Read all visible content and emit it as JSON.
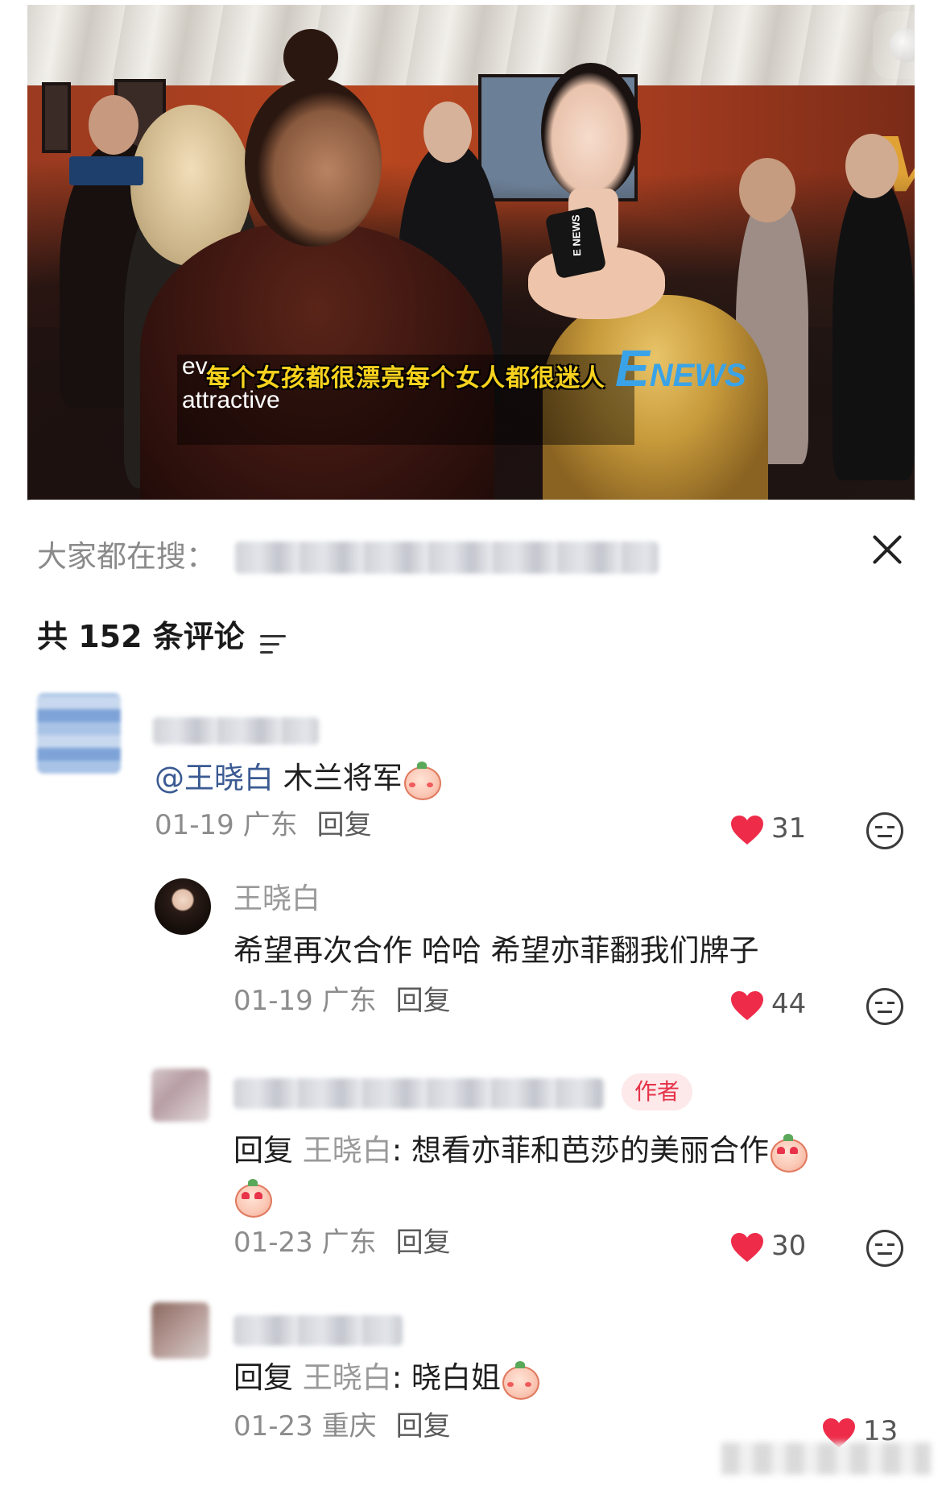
{
  "video": {
    "subtitle_en_line1": "ev",
    "subtitle_en_line2": "attractive",
    "subtitle_zh": "每个女孩都很漂亮每个女人都很迷人",
    "logo_e": "E",
    "logo_news": "NEWS",
    "mic_label": "E NEWS"
  },
  "search": {
    "label": "大家都在搜："
  },
  "comments_header": {
    "count_text": "共 152 条评论"
  },
  "comments": [
    {
      "mention": "@王晓白",
      "text": " 木兰将军",
      "date_location": "01-19 广东",
      "reply_label": "回复",
      "likes": "31"
    },
    {
      "username": "王晓白",
      "text": "希望再次合作 哈哈 希望亦菲翻我们牌子",
      "date_location": "01-19 广东",
      "reply_label": "回复",
      "likes": "44"
    },
    {
      "author_tag": "作者",
      "reply_prefix": "回复 ",
      "reply_to": "王晓白",
      "text": ": 想看亦菲和芭莎的美丽合作",
      "date_location": "01-23 广东",
      "reply_label": "回复",
      "likes": "30"
    },
    {
      "reply_prefix": "回复 ",
      "reply_to": "王晓白",
      "text": ": 晓白姐",
      "date_location": "01-23 重庆",
      "reply_label": "回复",
      "likes": "13"
    }
  ],
  "colors": {
    "heart": "#ee2c4a",
    "mention": "#3a5a92",
    "author_tag_bg": "#fde8ea",
    "author_tag_text": "#e5334a"
  },
  "icons": [
    "close-icon",
    "filter-icon",
    "heart-icon",
    "dislike-icon",
    "emoji-icon"
  ]
}
